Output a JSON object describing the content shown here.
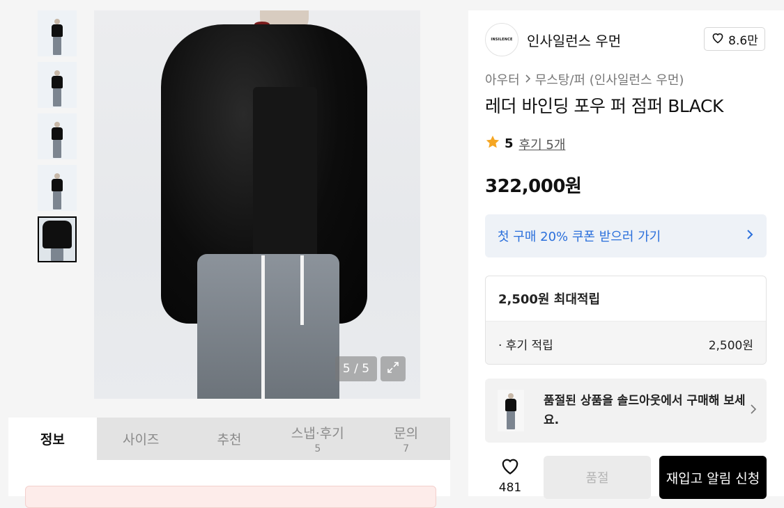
{
  "gallery": {
    "counter": "5 / 5",
    "thumbnail_count": 5,
    "active_index": 5
  },
  "tabs": [
    {
      "label": "정보",
      "count": ""
    },
    {
      "label": "사이즈",
      "count": ""
    },
    {
      "label": "추천",
      "count": ""
    },
    {
      "label": "스냅·후기",
      "count": "5"
    },
    {
      "label": "문의",
      "count": "7"
    }
  ],
  "brand": {
    "logo_text": "INSILENCE",
    "name": "인사일런스 우먼",
    "likes": "8.6만"
  },
  "breadcrumb": {
    "category": "아우터",
    "subcategory": "무스탕/퍼 (인사일런스 우먼)"
  },
  "product": {
    "title": "레더 바인딩 포우 퍼 점퍼 BLACK",
    "rating": "5",
    "review_link": "후기 5개",
    "price": "322,000원"
  },
  "coupon": {
    "label": "첫 구매 20% 쿠폰 받으러 가기"
  },
  "points": {
    "max_label": "2,500원 최대적립",
    "review_label": "· 후기 적립",
    "review_value": "2,500원"
  },
  "soldout_banner": {
    "text": "품절된 상품을 솔드아웃에서 구매해 보세요."
  },
  "actions": {
    "wish_count": "481",
    "soldout_label": "품절",
    "restock_label": "재입고 알림 신청"
  },
  "colors": {
    "coupon_text": "#2a6fdb",
    "rating_star": "#f5a623",
    "primary_button": "#000000"
  }
}
